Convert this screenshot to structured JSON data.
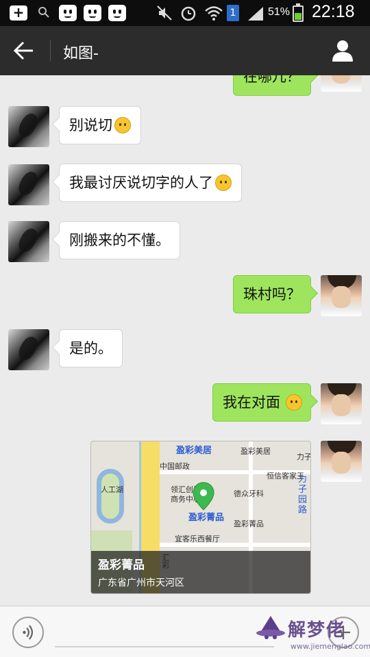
{
  "status_bar": {
    "sim_label": "1",
    "battery_percent": "51%",
    "battery_level": 0.51,
    "time": "22:18",
    "icons": [
      "add-icon",
      "search-icon",
      "robot-face-icon",
      "robot-face-icon",
      "robot-face-icon",
      "mute-icon",
      "alarm-icon",
      "wifi-icon",
      "sim-icon",
      "signal-icon",
      "battery-icon"
    ]
  },
  "header": {
    "title": "如图-",
    "back_icon": "arrow-left-icon",
    "profile_icon": "person-icon"
  },
  "messages": [
    {
      "side": "right",
      "text": "在哪儿？",
      "partial": true
    },
    {
      "side": "left",
      "text": "别说切",
      "emoji": "shy-smile-emoji"
    },
    {
      "side": "left",
      "text": "我最讨厌说切字的人了",
      "emoji": "smile-emoji"
    },
    {
      "side": "left",
      "text": "刚搬来的不懂。"
    },
    {
      "side": "right",
      "text": "珠村吗？"
    },
    {
      "side": "left",
      "text": "是的。"
    },
    {
      "side": "right",
      "text": "我在对面",
      "emoji": "laugh-cry-emoji"
    }
  ],
  "location": {
    "name": "盈彩菁品",
    "address": "广东省广州市天河区",
    "map_labels": {
      "top_center": "盈彩美居",
      "top_right_1": "盈彩美居",
      "top_right_2": "力子",
      "post": "中国邮政",
      "hengxin": "恒信客家王",
      "lake": "人工湖",
      "building": "领汇创展",
      "business": "商务中心",
      "dental": "德众牙科",
      "pin_label": "盈彩菁品",
      "small": "盈彩菁品",
      "restaurant": "宜客乐西餐厅",
      "road": "汇彩",
      "corner": "丽",
      "corner2": "力子园路"
    }
  },
  "input": {
    "placeholder": "",
    "voice_icon": "voice-icon",
    "plus_icon": "plus-icon"
  },
  "watermark": {
    "text": "解梦佬",
    "url": "www.jiemenglao.com"
  }
}
